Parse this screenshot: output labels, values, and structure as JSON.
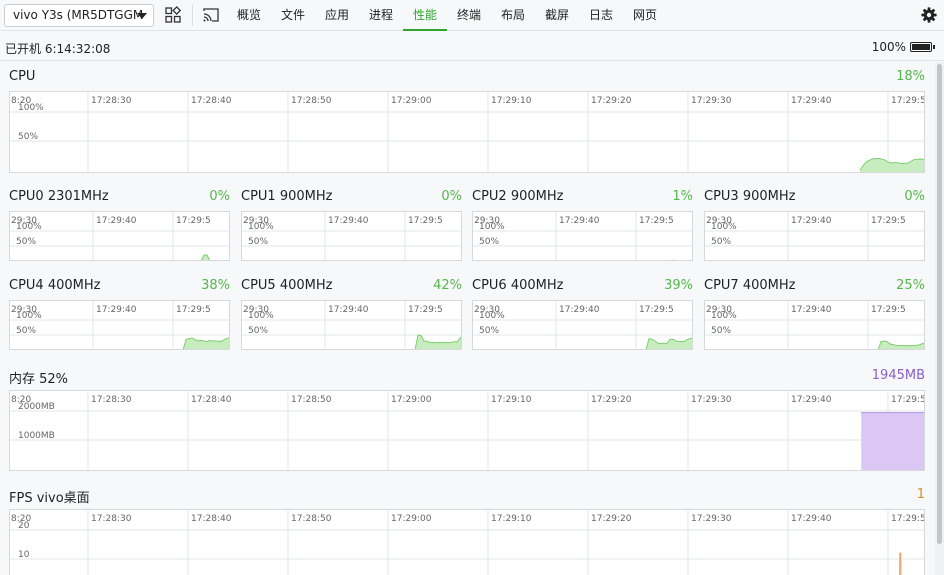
{
  "toolbar": {
    "device": "vivo Y3s (MR5DTGGM",
    "tabs": [
      {
        "label": "概览",
        "active": false
      },
      {
        "label": "文件",
        "active": false
      },
      {
        "label": "应用",
        "active": false
      },
      {
        "label": "进程",
        "active": false
      },
      {
        "label": "性能",
        "active": true
      },
      {
        "label": "终端",
        "active": false
      },
      {
        "label": "布局",
        "active": false
      },
      {
        "label": "截屏",
        "active": false
      },
      {
        "label": "日志",
        "active": false
      },
      {
        "label": "网页",
        "active": false
      }
    ],
    "icons": [
      "grid-icon",
      "cast-icon",
      "gear-icon"
    ]
  },
  "status": {
    "uptime": "已开机 6:14:32:08",
    "battery_percent": "100%",
    "battery_level": 1.0
  },
  "colors": {
    "accent": "#2ea62e",
    "cpu_fill": "#c7ecc0",
    "cpu_line": "#7ccf6f",
    "mem_fill": "#dac7f3",
    "mem_line": "#b48ee6",
    "fps_fill": "#f8d2ae",
    "fps_line": "#eca25e",
    "grid": "#e3e5e7"
  },
  "cpu": {
    "title": "CPU",
    "value": "18%",
    "ticks": [
      "8:20",
      "17:28:30",
      "17:28:40",
      "17:28:50",
      "17:29:00",
      "17:29:10",
      "17:29:20",
      "17:29:30",
      "17:29:40",
      "17:29:5"
    ],
    "ylabels": [
      "100%",
      "50%"
    ],
    "recent": [
      0,
      14,
      19,
      20,
      18,
      12,
      13,
      11,
      12,
      18,
      19,
      18
    ]
  },
  "cores": [
    {
      "title": "CPU0 2301MHz",
      "value": "0%",
      "recent": [
        0,
        0,
        0,
        0,
        0,
        0,
        0,
        20,
        20,
        0,
        0,
        0,
        0,
        0,
        0,
        0,
        0
      ]
    },
    {
      "title": "CPU1 900MHz",
      "value": "0%",
      "recent": []
    },
    {
      "title": "CPU2 900MHz",
      "value": "1%",
      "recent": [
        0,
        0,
        0,
        0,
        0,
        0,
        0,
        0,
        2,
        2,
        2,
        0,
        0,
        0,
        0,
        0,
        1
      ]
    },
    {
      "title": "CPU3 900MHz",
      "value": "0%",
      "recent": []
    },
    {
      "title": "CPU4 400MHz",
      "value": "38%",
      "recent": [
        0,
        35,
        38,
        40,
        35,
        30,
        32,
        30,
        28,
        32,
        30,
        30,
        28,
        30,
        36,
        40,
        38
      ]
    },
    {
      "title": "CPU5 400MHz",
      "value": "42%",
      "recent": [
        0,
        50,
        48,
        30,
        28,
        26,
        25,
        24,
        25,
        24,
        26,
        24,
        25,
        28,
        26,
        40,
        42
      ]
    },
    {
      "title": "CPU6 400MHz",
      "value": "39%",
      "recent": [
        0,
        38,
        36,
        30,
        22,
        22,
        22,
        22,
        35,
        36,
        30,
        28,
        28,
        30,
        36,
        39,
        39
      ]
    },
    {
      "title": "CPU7 400MHz",
      "value": "25%",
      "recent": [
        0,
        28,
        30,
        28,
        20,
        18,
        16,
        15,
        15,
        14,
        15,
        14,
        15,
        16,
        18,
        22,
        25
      ]
    }
  ],
  "core_ticks": [
    "29:30",
    "17:29:40",
    "17:29:5"
  ],
  "core_ylabels": [
    "100%",
    "50%"
  ],
  "memory": {
    "title": "内存 52%",
    "value": "1945MB",
    "ticks": [
      "8:20",
      "17:28:30",
      "17:28:40",
      "17:28:50",
      "17:29:00",
      "17:29:10",
      "17:29:20",
      "17:29:30",
      "17:29:40",
      "17:29:5"
    ],
    "ylabels": [
      "2000MB",
      "1000MB"
    ],
    "recent": [
      1945,
      1945,
      1945,
      1945,
      1945,
      1945,
      1945,
      1945,
      1945,
      1945,
      1945,
      1945,
      1945
    ]
  },
  "fps": {
    "title": "FPS vivo桌面",
    "value": "1",
    "ticks": [
      "8:20",
      "17:28:30",
      "17:28:40",
      "17:28:50",
      "17:29:00",
      "17:29:10",
      "17:29:20",
      "17:29:30",
      "17:29:40",
      "17:29:5"
    ],
    "ylabels": [
      "20",
      "10"
    ],
    "recent": [
      0,
      0,
      0,
      0,
      0,
      0,
      0,
      0,
      0,
      0,
      0,
      0,
      0,
      0,
      0,
      0,
      0,
      0,
      0,
      0,
      0,
      0,
      0,
      0,
      0,
      0,
      0,
      0,
      0,
      0,
      0,
      0,
      0,
      0,
      0,
      0,
      0,
      0,
      0,
      0,
      0,
      0,
      0,
      0,
      0,
      0,
      0,
      0,
      0,
      0,
      0,
      0,
      0,
      0,
      0,
      0,
      0,
      0,
      0,
      0,
      0,
      0,
      0,
      0,
      0,
      0,
      0,
      0,
      0,
      0,
      0,
      0,
      0,
      0,
      0,
      0,
      0,
      0,
      0,
      0,
      0,
      0,
      0,
      0,
      0,
      0,
      0,
      0,
      0,
      0,
      0,
      0,
      0,
      0,
      0,
      0,
      12,
      12,
      12,
      12,
      0,
      0,
      0,
      0,
      0,
      0,
      0,
      0,
      0,
      0,
      0,
      0,
      0,
      0,
      0,
      0,
      0,
      0,
      0,
      0,
      0,
      0,
      0,
      0,
      0,
      0,
      0,
      0,
      0,
      0,
      0,
      0,
      0,
      0,
      0,
      0,
      0,
      0,
      0,
      0,
      0,
      0,
      0,
      0,
      0,
      0,
      0,
      0,
      0,
      0,
      0,
      0,
      0,
      0,
      0,
      0,
      0,
      0,
      0,
      0,
      0,
      0,
      0,
      0,
      0,
      0,
      0,
      0,
      0,
      0,
      0,
      0,
      0,
      0
    ]
  }
}
